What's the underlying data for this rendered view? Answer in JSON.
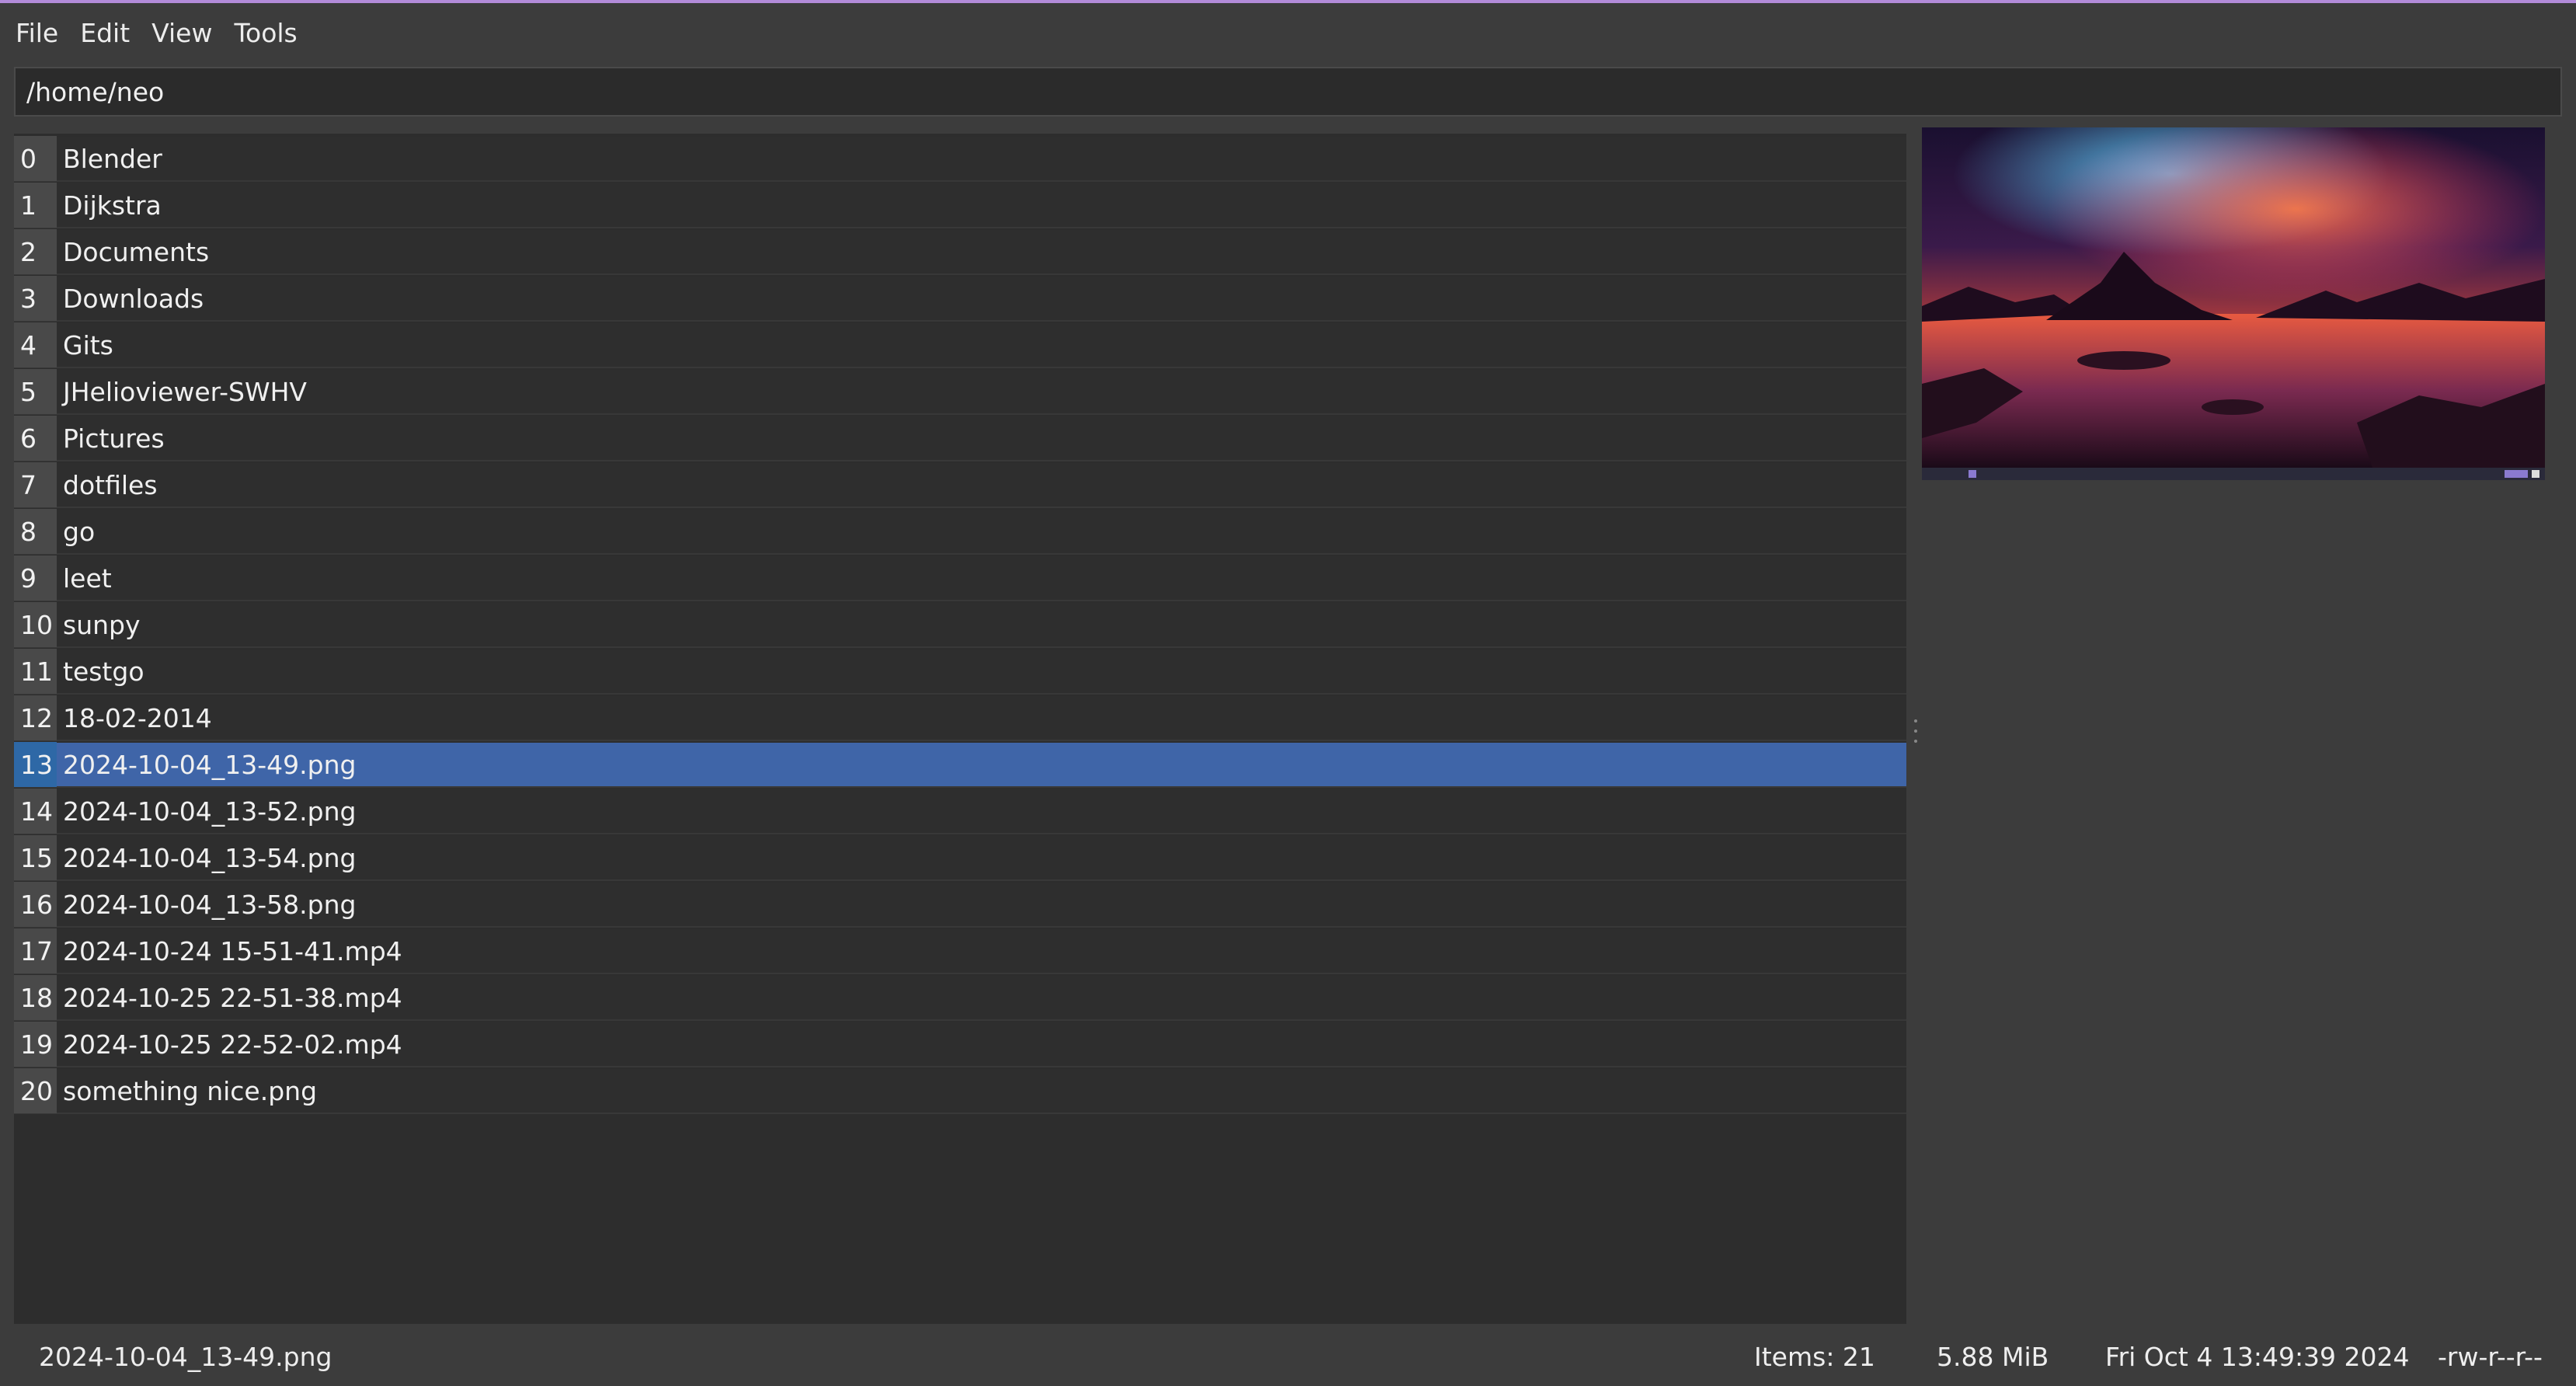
{
  "menu": {
    "file": "File",
    "edit": "Edit",
    "view": "View",
    "tools": "Tools"
  },
  "path": "/home/neo",
  "files": [
    {
      "index": "0",
      "name": "Blender"
    },
    {
      "index": "1",
      "name": "Dijkstra"
    },
    {
      "index": "2",
      "name": "Documents"
    },
    {
      "index": "3",
      "name": "Downloads"
    },
    {
      "index": "4",
      "name": "Gits"
    },
    {
      "index": "5",
      "name": "JHelioviewer-SWHV"
    },
    {
      "index": "6",
      "name": "Pictures"
    },
    {
      "index": "7",
      "name": "dotfiles"
    },
    {
      "index": "8",
      "name": "go"
    },
    {
      "index": "9",
      "name": "leet"
    },
    {
      "index": "10",
      "name": "sunpy"
    },
    {
      "index": "11",
      "name": "testgo"
    },
    {
      "index": "12",
      "name": "18-02-2014"
    },
    {
      "index": "13",
      "name": "2024-10-04_13-49.png"
    },
    {
      "index": "14",
      "name": "2024-10-04_13-52.png"
    },
    {
      "index": "15",
      "name": "2024-10-04_13-54.png"
    },
    {
      "index": "16",
      "name": "2024-10-04_13-58.png"
    },
    {
      "index": "17",
      "name": "2024-10-24 15-51-41.mp4"
    },
    {
      "index": "18",
      "name": "2024-10-25 22-51-38.mp4"
    },
    {
      "index": "19",
      "name": "2024-10-25 22-52-02.mp4"
    },
    {
      "index": "20",
      "name": "something nice.png"
    }
  ],
  "selected_index": 13,
  "status": {
    "filename": "2024-10-04_13-49.png",
    "items": "Items:  21",
    "size": "5.88 MiB",
    "modified": "Fri Oct 4 13:49:39 2024",
    "permissions": "-rw-r--r--"
  },
  "colors": {
    "accent_border": "#b28bd9",
    "selection": "#3f65a8",
    "selection_index": "#2e68a6"
  },
  "preview": {
    "icon": "image-preview-thumbnail"
  }
}
